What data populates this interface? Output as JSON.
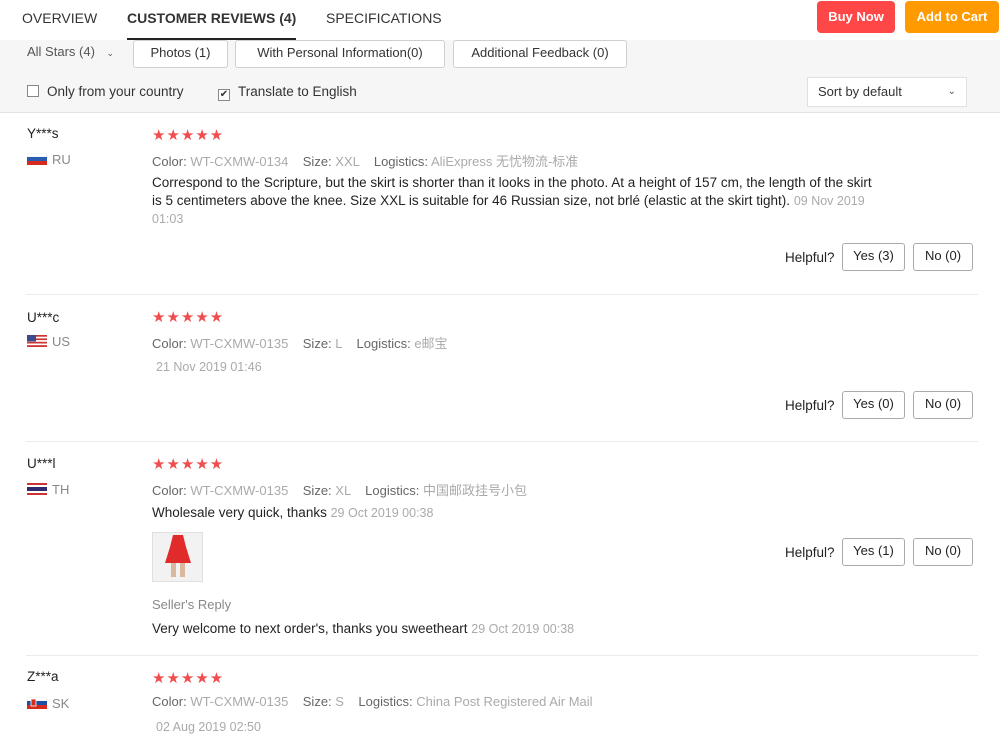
{
  "nav": {
    "tabs": [
      {
        "label": "OVERVIEW"
      },
      {
        "label": "CUSTOMER REVIEWS (4)"
      },
      {
        "label": "SPECIFICATIONS"
      }
    ],
    "buy_now": "Buy Now",
    "add_to_cart": "Add to Cart"
  },
  "filters": {
    "all_stars": "All Stars (4)",
    "photos": "Photos (1)",
    "personal": "With Personal Information(0)",
    "additional": "Additional Feedback (0)",
    "only_country": "Only from your country",
    "translate": "Translate to English",
    "sort": "Sort by default"
  },
  "labels": {
    "color": "Color:",
    "size": "Size:",
    "logistics": "Logistics:",
    "helpful": "Helpful?",
    "seller_reply": "Seller's Reply"
  },
  "reviews": [
    {
      "user": "Y***s",
      "country": "RU",
      "stars": "★★★★★",
      "color": "WT-CXMW-0134",
      "size": "XXL",
      "logistics": "AliExpress 无忧物流-标准",
      "text": "Correspond to the Scripture, but the skirt is shorter than it looks in the photo. At a height of 157 cm, the length of the skirt is 5 centimeters above the knee. Size XXL is suitable for 46 Russian size, not brlé (elastic at the skirt tight).",
      "date": "09 Nov 2019 01:03",
      "yes": "Yes (3)",
      "no": "No (0)"
    },
    {
      "user": "U***c",
      "country": "US",
      "stars": "★★★★★",
      "color": "WT-CXMW-0135",
      "size": "L",
      "logistics": "e邮宝",
      "text": "",
      "date": "21 Nov 2019 01:46",
      "yes": "Yes (0)",
      "no": "No (0)"
    },
    {
      "user": "U***l",
      "country": "TH",
      "stars": "★★★★★",
      "color": "WT-CXMW-0135",
      "size": "XL",
      "logistics": "中国邮政挂号小包",
      "text": "Wholesale very quick, thanks",
      "date": "29 Oct 2019 00:38",
      "yes": "Yes (1)",
      "no": "No (0)",
      "reply": "Very welcome to next order's, thanks you sweetheart",
      "reply_date": "29 Oct 2019 00:38"
    },
    {
      "user": "Z***a",
      "country": "SK",
      "stars": "★★★★★",
      "color": "WT-CXMW-0135",
      "size": "S",
      "logistics": "China Post Registered Air Mail",
      "text": "",
      "date": "02 Aug 2019 02:50"
    }
  ]
}
